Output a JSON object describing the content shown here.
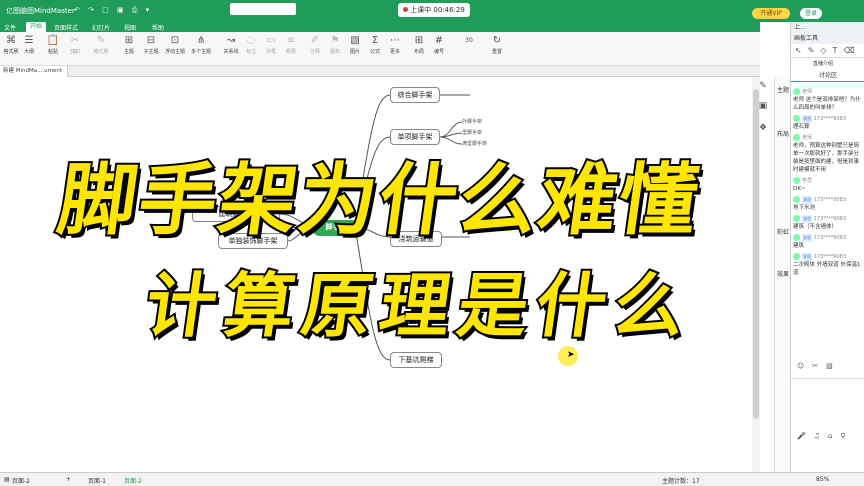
{
  "titlebar": {
    "app_name": "亿图脑图MindMaster",
    "quick_access": "↶ ↷ ▢ ▣ ⎙ ▾",
    "timer_label": "上课中 00:46:29",
    "vip_label": "开通VIP",
    "login_label": "登录"
  },
  "menu": {
    "items": [
      "文件",
      "开始",
      "页面样式",
      "幻灯片",
      "视图",
      "帮助"
    ],
    "active": "开始"
  },
  "toolbar": {
    "tools": [
      {
        "icon": "⌘",
        "label": "格式刷"
      },
      {
        "icon": "☰",
        "label": "大纲"
      },
      {
        "icon": "📋",
        "label": "粘贴"
      },
      {
        "icon": "✂",
        "label": "剪切"
      },
      {
        "icon": "⧉",
        "label": "复制"
      },
      {
        "icon": "✎",
        "label": "格式刷"
      },
      {
        "icon": "⊞",
        "label": "主题"
      },
      {
        "icon": "⊟",
        "label": "子主题"
      },
      {
        "icon": "⊡",
        "label": "浮动主题"
      },
      {
        "icon": "⋔",
        "label": "多个主题"
      },
      {
        "icon": "↝",
        "label": "关系线"
      },
      {
        "icon": "◌",
        "label": "标注"
      },
      {
        "icon": "▭",
        "label": "外框"
      },
      {
        "icon": "≡",
        "label": "概要"
      },
      {
        "icon": "✐",
        "label": "注释"
      },
      {
        "icon": "⚑",
        "label": "图标"
      },
      {
        "icon": "▧",
        "label": "图片"
      },
      {
        "icon": "Σ",
        "label": "公式"
      },
      {
        "icon": "⋯",
        "label": "更多"
      },
      {
        "icon": "⊞",
        "label": "布局"
      },
      {
        "icon": "#",
        "label": "编号"
      },
      {
        "icon": "30",
        "label": ""
      },
      {
        "icon": "↻",
        "label": "重置"
      }
    ]
  },
  "doc_tab": "新建 MindMa....ument (3)",
  "mindmap": {
    "center": "脚手架",
    "nodes": [
      "综合脚手架",
      "单项脚手架",
      "建筑脚手架",
      "单独装饰脚手架",
      "浇筑运输道",
      "下基坑爬梯"
    ],
    "subs": [
      "外脚手架",
      "里脚手架",
      "满堂脚手架"
    ]
  },
  "overlay": {
    "line1": "脚手架为什么难懂",
    "line2": "计算原理是什么"
  },
  "right_panel": {
    "labels": [
      "主题",
      "布局",
      "彩虹",
      "效果"
    ]
  },
  "chat": {
    "header1": "上...",
    "header2": "画板工具",
    "section_title": "讨论区",
    "right_label": "直播介绍",
    "messages": [
      {
        "who": "老师",
        "text": "老师 这个是双排架吧？为什么四周的叫单排？"
      },
      {
        "who": "173****9083",
        "text": "理石算"
      },
      {
        "who": "老师",
        "text": "老师，预算这种别墅只是简单一次那就好了，那手架分装是按里面的建，但是到事时建模就不用"
      },
      {
        "who": "学员",
        "text": "OK~"
      },
      {
        "who": "173****9083",
        "text": "地下水池"
      },
      {
        "who": "173****9083",
        "text": "建筑（不含墙体）"
      },
      {
        "who": "173****9083",
        "text": "建筑"
      },
      {
        "who": "173****9083",
        "text": "二次砌体 外墙双道 外保温1道"
      }
    ]
  },
  "status": {
    "page_prev": "页面-2",
    "page_1": "页面-1",
    "page_2": "页面-2",
    "topic_count": "主题计数：17",
    "zoom": "85%"
  }
}
